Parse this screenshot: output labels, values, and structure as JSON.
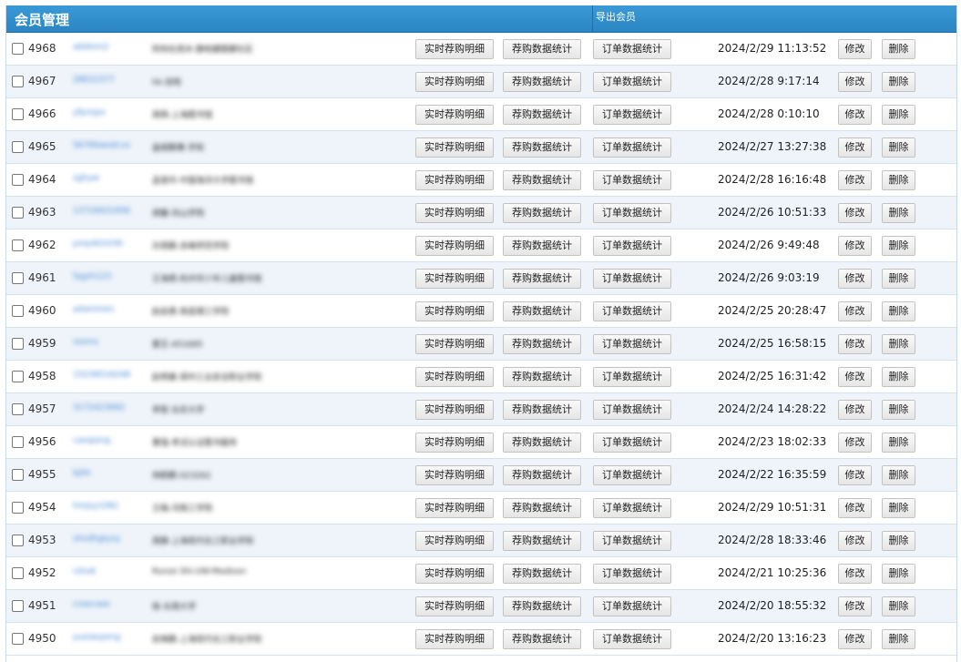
{
  "header": {
    "title": "会员管理",
    "export_label": "导出会员"
  },
  "buttons": {
    "detail": "实时荐购明细",
    "stats": "荐购数据统计",
    "orders": "订单数据统计",
    "edit": "修改",
    "delete": "删除"
  },
  "rows": [
    {
      "id": "4968",
      "username": "abbkim2",
      "school": "阿布杜西木·静哈娜图娜社区",
      "time": "2024/2/29 11:13:52"
    },
    {
      "id": "4967",
      "username": "28631577",
      "school": "hk-加哈",
      "time": "2024/2/28 9:17:14"
    },
    {
      "id": "4966",
      "username": "yfpnzpx",
      "school": "周杨-上海图书馆",
      "time": "2024/2/28 0:10:10"
    },
    {
      "id": "4965",
      "username": "56766wedcvx",
      "school": "盖斌鹏惠-学校",
      "time": "2024/2/27 13:27:38"
    },
    {
      "id": "4964",
      "username": "zghyw",
      "school": "孟俊玲-中国海洋大学图书馆",
      "time": "2024/2/28 16:16:48"
    },
    {
      "id": "4963",
      "username": "13716631956",
      "school": "胡馨-坊山学院",
      "time": "2024/2/26 10:51:33"
    },
    {
      "id": "4962",
      "username": "pmp401036",
      "school": "孙周鹏-赤峰师范学院",
      "time": "2024/2/26 9:49:48"
    },
    {
      "id": "4961",
      "username": "fagzh123",
      "school": "王海燕-杭州市少年儿童图书馆",
      "time": "2024/2/26 9:03:19"
    },
    {
      "id": "4960",
      "username": "adammen",
      "school": "赵启勇-南昌理工学院",
      "time": "2024/2/25 20:28:47"
    },
    {
      "id": "4959",
      "username": "romns",
      "school": "蒙芷-451685",
      "time": "2024/2/25 16:58:15"
    },
    {
      "id": "4958",
      "username": "15238516248",
      "school": "赵明睿-郑州工业安全职业学院",
      "time": "2024/2/25 16:31:42"
    },
    {
      "id": "4957",
      "username": "3172423692",
      "school": "李智-长庆大学",
      "time": "2024/2/24 14:28:22"
    },
    {
      "id": "4956",
      "username": "caoqiang",
      "school": "曹强-考试认证图书服务",
      "time": "2024/2/23 18:02:33"
    },
    {
      "id": "4955",
      "username": "bjhh",
      "school": "林鹤鹏-023262",
      "time": "2024/2/22 16:35:59"
    },
    {
      "id": "4954",
      "username": "hmjxy1081",
      "school": "王梅-河南工学院",
      "time": "2024/2/29 10:51:31"
    },
    {
      "id": "4953",
      "username": "shxdhgtyxy",
      "school": "周静-上海现代化工职业学院",
      "time": "2024/2/28 18:33:46"
    },
    {
      "id": "4952",
      "username": "rshx6",
      "school": "Runze Shi-UW-Madison",
      "time": "2024/2/21 10:25:36"
    },
    {
      "id": "4951",
      "username": "creecxee",
      "school": "桂-长南大学",
      "time": "2024/2/20 18:55:32"
    },
    {
      "id": "4950",
      "username": "yuxiaoyeng",
      "school": "俞晓鹏-上海现代化工职业学院",
      "time": "2024/2/20 13:16:23"
    }
  ]
}
